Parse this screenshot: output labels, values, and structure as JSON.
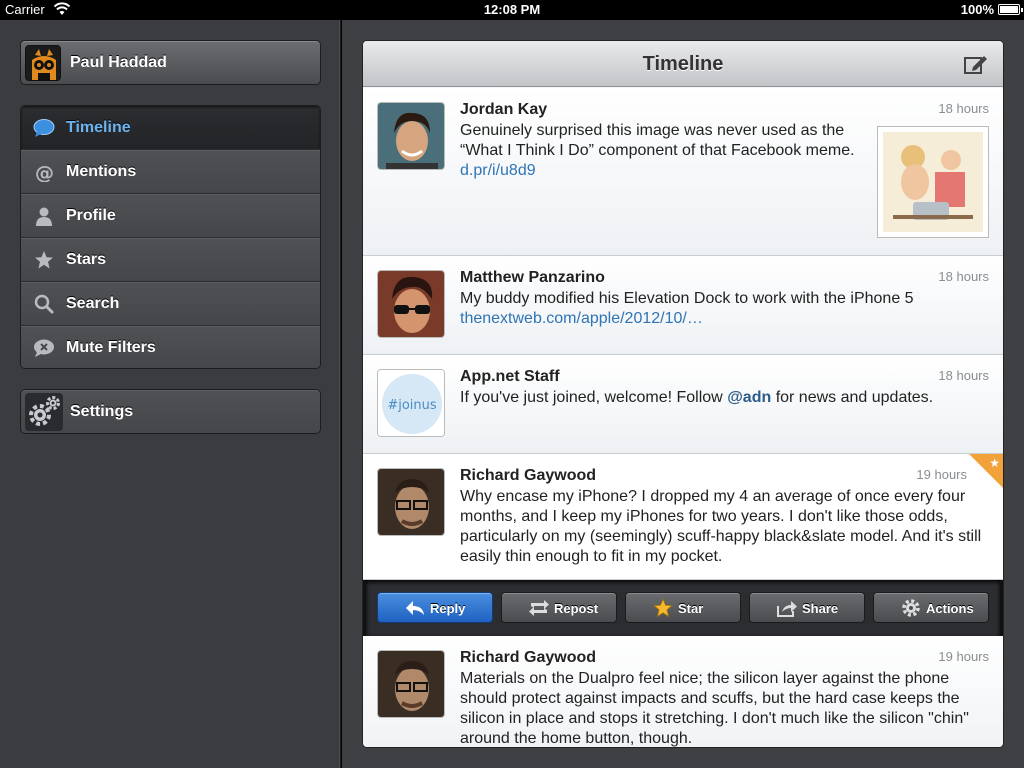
{
  "status_bar": {
    "carrier": "Carrier",
    "time": "12:08 PM",
    "battery": "100%"
  },
  "sidebar": {
    "account": {
      "name": "Paul Haddad"
    },
    "nav": [
      {
        "label": "Timeline",
        "icon": "speech-bubble-icon",
        "active": true
      },
      {
        "label": "Mentions",
        "icon": "at-sign-icon",
        "active": false
      },
      {
        "label": "Profile",
        "icon": "person-icon",
        "active": false
      },
      {
        "label": "Stars",
        "icon": "star-icon",
        "active": false
      },
      {
        "label": "Search",
        "icon": "magnifier-icon",
        "active": false
      },
      {
        "label": "Mute Filters",
        "icon": "mute-bubble-icon",
        "active": false
      }
    ],
    "settings": {
      "label": "Settings",
      "icon": "gears-icon"
    }
  },
  "main": {
    "title": "Timeline",
    "posts": [
      {
        "author": "Jordan Kay",
        "time": "18 hours",
        "text": "Genuinely surprised this image was never used as the “What I Think I Do” component of that Facebook meme.",
        "link": "d.pr/i/u8d9"
      },
      {
        "author": "Matthew Panzarino",
        "time": "18 hours",
        "text": "My buddy modified his Elevation Dock to work with the iPhone 5",
        "link": "thenextweb.com/apple/2012/10/…"
      },
      {
        "author": "App.net Staff",
        "avatar_text": "#joinus",
        "time": "18 hours",
        "text_before": "If you've just joined, welcome! Follow",
        "mention": "@adn",
        "text_after": "for news and updates."
      },
      {
        "author": "Richard Gaywood",
        "time": "19 hours",
        "starred": true,
        "text": "Why encase my iPhone? I dropped my 4 an average of once every four months, and I keep my iPhones for two years. I don't like those odds, particularly on my (seemingly) scuff-happy black&slate model. And it's still easily thin enough to fit in my pocket."
      },
      {
        "author": "Richard Gaywood",
        "time": "19 hours",
        "text": "Materials on the Dualpro feel nice; the silicon layer against the phone should protect against impacts and scuffs, but the hard case keeps the silicon in place and stops it stretching. I don't much like the silicon \"chin\" around the home button, though."
      }
    ],
    "actions": [
      {
        "label": "Reply",
        "icon": "reply-arrow-icon"
      },
      {
        "label": "Repost",
        "icon": "repost-arrows-icon"
      },
      {
        "label": "Star",
        "icon": "star-icon"
      },
      {
        "label": "Share",
        "icon": "share-icon"
      },
      {
        "label": "Actions",
        "icon": "gear-icon"
      }
    ]
  },
  "colors": {
    "accent": "#6cb4f0",
    "link": "#2f74b5",
    "reply_button": "#2a6fd0",
    "star_flag": "#f2a23a"
  }
}
